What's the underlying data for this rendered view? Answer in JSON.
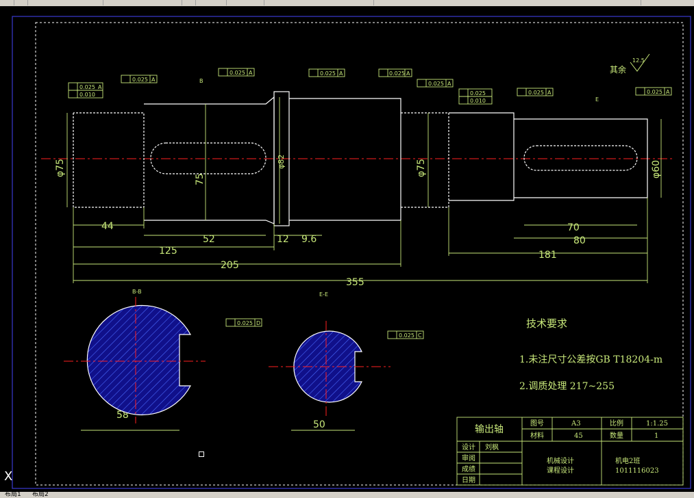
{
  "app": {
    "toolbar_icons": [
      "undo-icon",
      "redo-icon",
      "pan-icon",
      "zoom-realtime-icon",
      "zoom-window-icon",
      "zoom-previous-icon",
      "properties-icon",
      "layer-icon",
      "text-style-icon"
    ]
  },
  "layout_tabs": [
    "布局1",
    "布局2"
  ],
  "dimensions": {
    "d44": "44",
    "d125": "125",
    "d52": "52",
    "d12": "12",
    "d9_6": "9.6",
    "d205": "205",
    "d355": "355",
    "d70": "70",
    "d80": "80",
    "d181": "181",
    "d58": "58",
    "d50": "50",
    "d75": "75",
    "dia_left": "φ75",
    "dia_mid": "φ82",
    "dia_right": "φ75",
    "dia_key": "φ60"
  },
  "tolerance_frames": {
    "t1": "0.025",
    "t1b": "0.010",
    "t2": "0.025",
    "t3": "0.025",
    "t4": "0.025",
    "t5": "0.025",
    "t6": "0.025",
    "t7": "0.025",
    "t7b": "0.010",
    "t8": "0.025",
    "t9": "0.025",
    "t10": "0.025",
    "t11": "0.025"
  },
  "datums": {
    "a": "A",
    "b": "B",
    "c": "C",
    "d": "D",
    "e": "E"
  },
  "section_labels": {
    "bb": "B-B",
    "ee": "E-E"
  },
  "roughness": {
    "qiyu": "其余",
    "val": "12.5"
  },
  "tech": {
    "title": "技术要求",
    "line1": "1.未注尺寸公差按GB T18204-m",
    "line2": "2.调质处理 217~255"
  },
  "title_block": {
    "part_name": "输出轴",
    "drawing_no_label": "图号",
    "drawing_no": "A3",
    "scale_label": "比例",
    "scale": "1:1.25",
    "material_label": "材料",
    "material": "45",
    "qty_label": "数量",
    "qty": "1",
    "design_label": "设计",
    "designer": "刘枫",
    "review_label": "审阅",
    "grade_label": "成绩",
    "date_label": "日期",
    "course_1": "机械设计",
    "course_2": "课程设计",
    "class_name": "机电2班",
    "student_id": "1011116023"
  },
  "colors": {
    "green": "#c8e87a",
    "white": "#ffffff",
    "red": "#ff2020",
    "blue": "#1a1ad0",
    "border": "#3a3ad0"
  }
}
